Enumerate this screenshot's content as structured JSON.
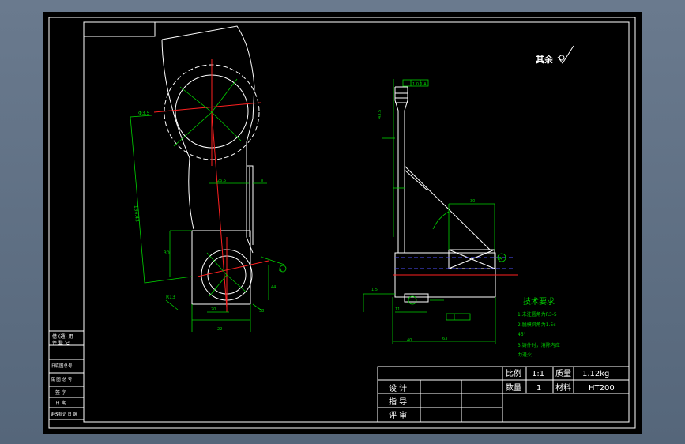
{
  "drawing": {
    "surface_note": "其余",
    "tech_req": {
      "title": "技术要求",
      "items": [
        "1.未注圆角为R3-5",
        "2.脱模斜角为1.5c",
        "45°",
        "3.铸件时，消除内应",
        "力退火"
      ]
    },
    "title_block": {
      "scale_label": "比例",
      "scale_value": "1:1",
      "mass_label": "质量",
      "mass_value": "1.12kg",
      "qty_label": "数量",
      "qty_value": "1",
      "material_label": "材料",
      "material_value": "HT200",
      "design_label": "设 计",
      "guide_label": "指 导",
      "review_label": "评 审"
    },
    "left_strip": [
      "借 (通) 用",
      "件 登 记",
      "旧底图总号",
      "底 图 总 号",
      "签 字",
      "日 期",
      "更改标记 日 期"
    ],
    "dims": {
      "d1": "Φ3.5",
      "d2": "184.43",
      "d3": "30",
      "d4": "R13",
      "d5": "26.5",
      "d6": "8",
      "d7": "1 0.1 A",
      "d8": "22",
      "d9": "20",
      "d10": "44",
      "d11": "38",
      "d12": "43.5",
      "d13": "40",
      "d14": "1.5",
      "d15": "11",
      "d16": "A",
      "d17": "63"
    },
    "colors": {
      "line": "#ffffff",
      "dim": "#00d200",
      "center": "#ff2020",
      "hidden": "#5050ff",
      "sheet": "#000000"
    }
  }
}
